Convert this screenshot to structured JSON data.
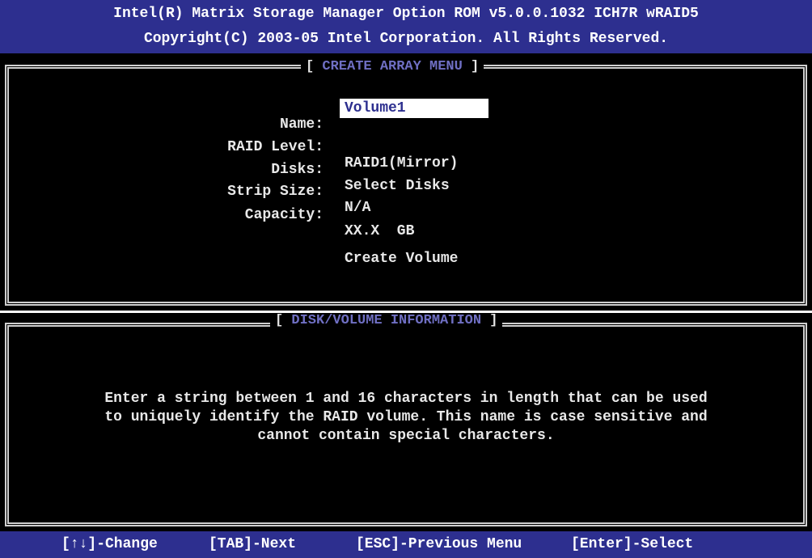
{
  "header": {
    "line1": "Intel(R) Matrix Storage Manager Option ROM v5.0.0.1032 ICH7R wRAID5",
    "line2": "Copyright(C) 2003-05 Intel Corporation. All Rights Reserved."
  },
  "create_menu": {
    "title": "CREATE ARRAY MENU",
    "fields": {
      "name_label": "Name:",
      "name_value": "Volume1",
      "raid_label": "RAID Level:",
      "raid_value": "RAID1(Mirror)",
      "disks_label": "Disks:",
      "disks_value": "Select Disks",
      "strip_label": "Strip Size:",
      "strip_value": "N/A",
      "capacity_label": "Capacity:",
      "capacity_value": "XX.X  GB"
    },
    "create_label": "Create Volume"
  },
  "info_panel": {
    "title": "DISK/VOLUME INFORMATION",
    "line1": "Enter a string between 1 and 16 characters in length that can be used",
    "line2": "to uniquely identify the RAID volume. This name is case sensitive and",
    "line3": "cannot contain special characters."
  },
  "footer": {
    "change": "[↑↓]-Change",
    "next": "[TAB]-Next",
    "previous": "[ESC]-Previous Menu",
    "select": "[Enter]-Select"
  },
  "colors": {
    "header_bg": "#2d2f8f",
    "panel_bg": "#000000",
    "title_text": "#6f6fc3",
    "body_text": "#e8e8e8",
    "selected_field_bg": "#ffffff"
  }
}
